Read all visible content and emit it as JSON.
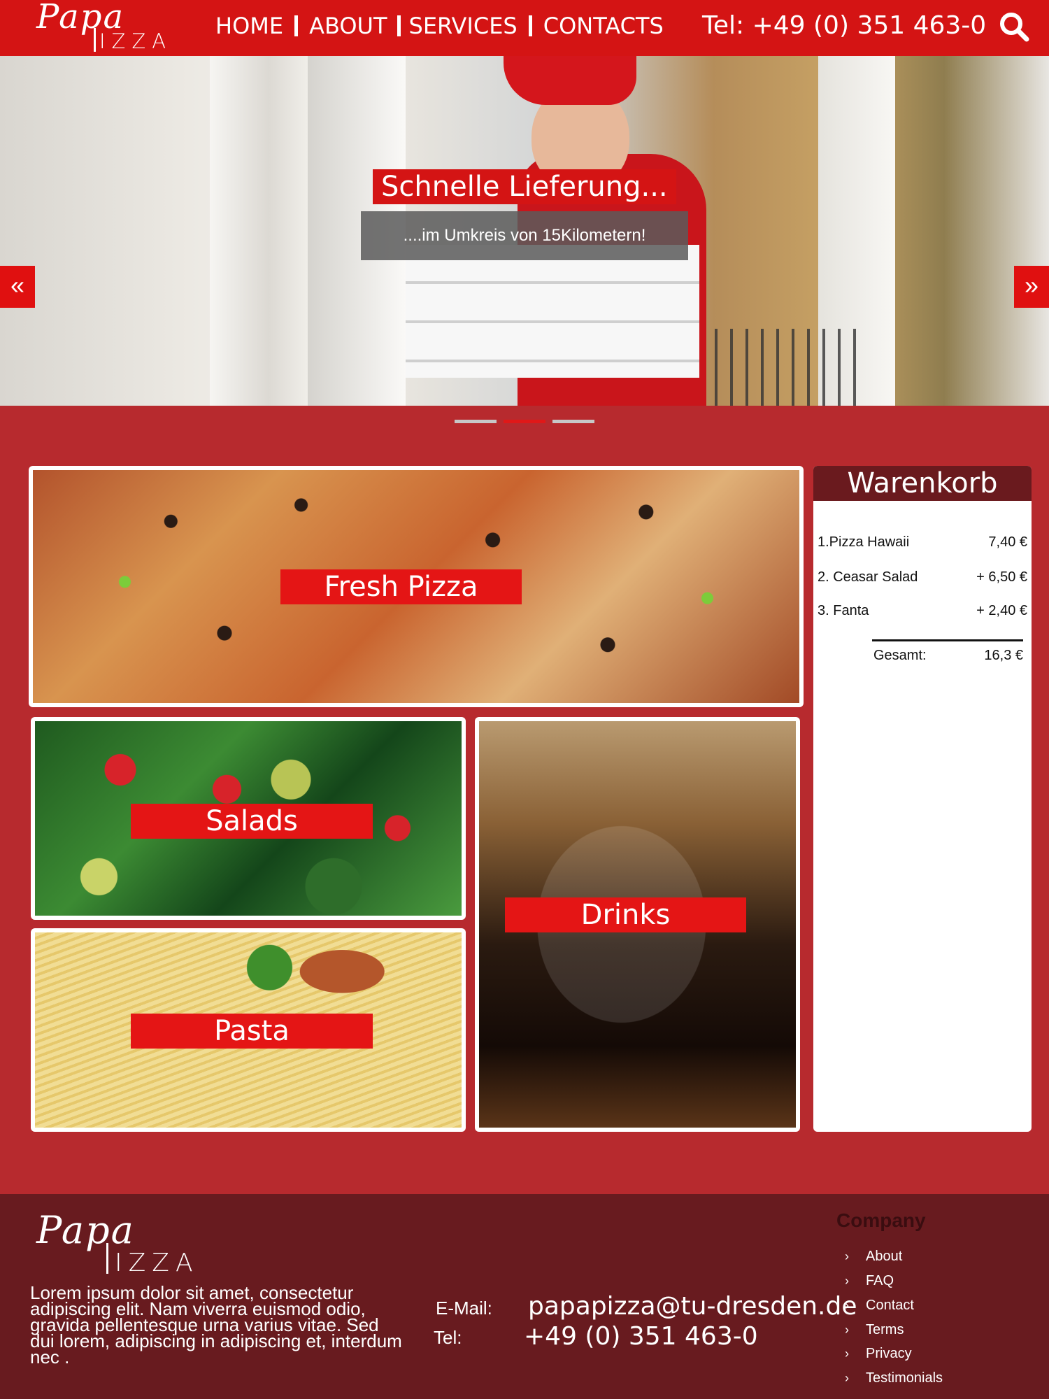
{
  "brand": {
    "logo_top": "Papa",
    "logo_bottom": "IZZA"
  },
  "nav": {
    "items": [
      "HOME",
      "ABOUT",
      "SERVICES",
      "CONTACTS"
    ]
  },
  "header": {
    "tel": "Tel: +49 (0) 351 463-0",
    "search_icon": "search-icon"
  },
  "hero": {
    "title": "Schnelle Lieferung...",
    "subtitle": "....im Umkreis von  15Kilometern!",
    "prev_icon": "«",
    "next_icon": "»",
    "slides": 3,
    "active_slide": 2
  },
  "tiles": {
    "pizza": "Fresh Pizza",
    "salads": "Salads",
    "drinks": "Drinks",
    "pasta": "Pasta"
  },
  "cart": {
    "title": "Warenkorb",
    "items": [
      {
        "name": "1.Pizza Hawaii",
        "price": "7,40 €"
      },
      {
        "name": "2. Ceasar Salad",
        "price": "+ 6,50 €"
      },
      {
        "name": "3. Fanta",
        "price": "+ 2,40 €"
      }
    ],
    "total_label": "Gesamt:",
    "total_value": "16,3 €"
  },
  "footer": {
    "text": "Lorem ipsum dolor sit amet, consectetur adipiscing elit. Nam viverra euismod odio, gravida pellentesque urna varius vitae. Sed dui lorem, adipiscing in adipiscing et, interdum nec .",
    "email_label": "E-Mail:",
    "email_value": "papapizza@tu-dresden.de",
    "tel_label": "Tel:",
    "tel_value": "+49 (0) 351 463-0",
    "company_title": "Company",
    "company_links": [
      "About",
      "FAQ",
      "Contact",
      "Terms",
      "Privacy",
      "Testimonials"
    ]
  },
  "colors": {
    "header_red": "#d41414",
    "page_red": "#b72a2e",
    "dark_red": "#681b1f",
    "label_red": "#e41515"
  }
}
